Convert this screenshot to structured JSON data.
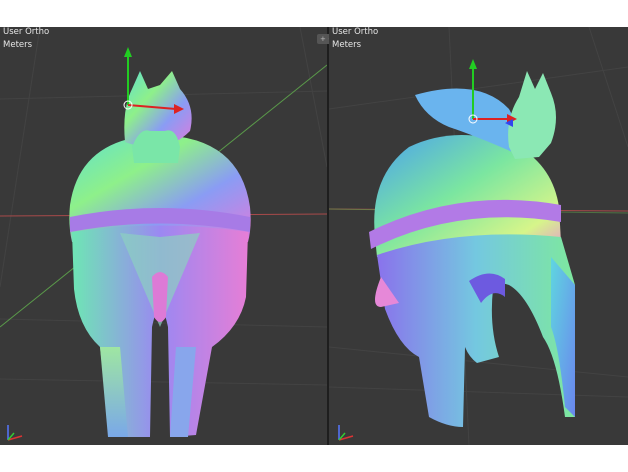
{
  "viewports": [
    {
      "view_name": "User Ortho",
      "units": "Meters"
    },
    {
      "view_name": "User Ortho",
      "units": "Meters"
    }
  ],
  "split_handle_glyph": "+ +",
  "colors": {
    "background": "#393939",
    "grid_line": "#434343",
    "x_axis": "#a84a4a",
    "y_axis": "#5a9a4a",
    "gizmo_z": "#22cc22",
    "gizmo_x": "#dd2222"
  },
  "icons": [
    "axis-gizmo-icon",
    "transform-manipulator-icon",
    "split-handle-icon"
  ]
}
